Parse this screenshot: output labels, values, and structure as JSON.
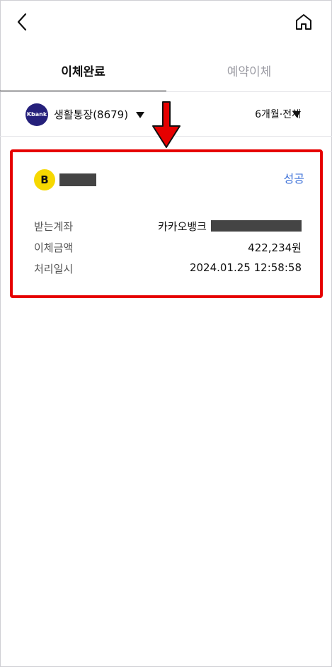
{
  "tabs": [
    {
      "label": "이체완료",
      "active": true
    },
    {
      "label": "예약이체",
      "active": false
    }
  ],
  "filters": {
    "bank_logo_text": "Kbank",
    "account": "생활통장(8679)",
    "period": "6개월·전체"
  },
  "card": {
    "recipient_logo": "B",
    "status": "성공",
    "rows": [
      {
        "label": "받는계좌",
        "value": "카카오뱅크"
      },
      {
        "label": "이체금액",
        "value": "422,234원"
      },
      {
        "label": "처리일시",
        "value": "2024.01.25 12:58:58"
      }
    ]
  },
  "colors": {
    "accent": "#3a6fd8",
    "highlight": "#e60000",
    "kbank": "#25207b",
    "recipient_logo": "#f6d800"
  },
  "icons": {
    "back": "chevron-left-icon",
    "home": "home-icon",
    "dropdown": "triangle-down-icon",
    "annotation": "arrow-down-icon"
  }
}
